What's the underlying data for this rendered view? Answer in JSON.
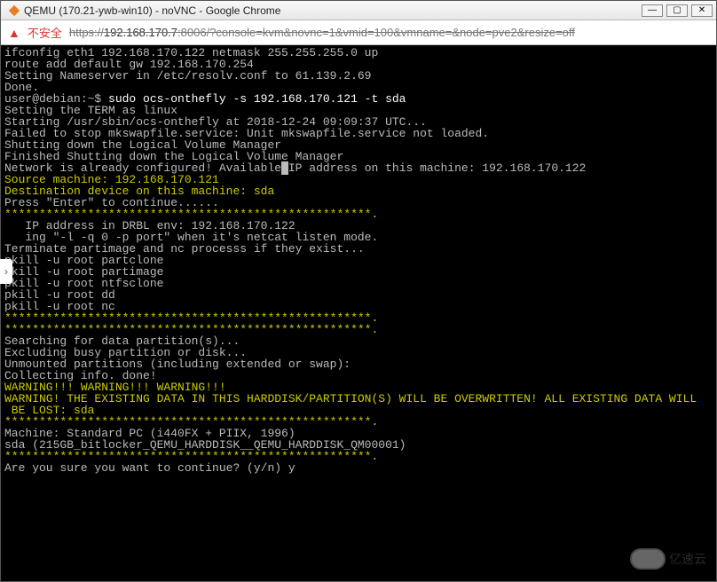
{
  "window": {
    "title": "QEMU (170.21-ywb-win10) - noVNC - Google Chrome",
    "min": "—",
    "max": "▢",
    "close": "✕"
  },
  "addressbar": {
    "insecure_label": "不安全",
    "url_prefix": "https://",
    "url_host": "192.168.170.7",
    "url_rest": ":8006/?console=kvm&novnc=1&vmid=100&vmname=&node=pve2&resize=off"
  },
  "side_tab": "›",
  "terminal": {
    "lines": [
      {
        "t": "ifconfig eth1 192.168.170.122 netmask 255.255.255.0 up"
      },
      {
        "t": "route add default gw 192.168.170.254"
      },
      {
        "t": "Setting Nameserver in /etc/resolv.conf to 61.139.2.69"
      },
      {
        "t": "Done."
      },
      {
        "segs": [
          {
            "t": "user@debian:~$ "
          },
          {
            "cls": "wh",
            "t": "sudo ocs-onthefly -s 192.168.170.121 -t sda"
          }
        ]
      },
      {
        "t": "Setting the TERM as linux"
      },
      {
        "t": "Starting /usr/sbin/ocs-onthefly at 2018-12-24 09:09:37 UTC..."
      },
      {
        "t": "Failed to stop mkswapfile.service: Unit mkswapfile.service not loaded."
      },
      {
        "t": "Shutting down the Logical Volume Manager"
      },
      {
        "t": "Finished Shutting down the Logical Volume Manager"
      },
      {
        "segs": [
          {
            "t": "Network is already configured! Available"
          },
          {
            "cls": "cursor",
            "t": " "
          },
          {
            "t": "IP address on this machine: 192.168.170.122"
          }
        ]
      },
      {
        "cls": "yl",
        "t": "Source machine: 192.168.170.121"
      },
      {
        "cls": "yl",
        "t": "Destination device on this machine: sda"
      },
      {
        "t": "Press \"Enter\" to continue......"
      },
      {
        "cls": "yl",
        "t": "*****************************************************."
      },
      {
        "t": "   IP address in DRBL env: 192.168.170.122"
      },
      {
        "t": "   ing \"-l -q 0 -p port\" when it's netcat listen mode."
      },
      {
        "t": "Terminate partimage and nc processs if they exist..."
      },
      {
        "t": "pkill -u root partclone"
      },
      {
        "t": "pkill -u root partimage"
      },
      {
        "t": "pkill -u root ntfsclone"
      },
      {
        "t": "pkill -u root dd"
      },
      {
        "t": "pkill -u root nc"
      },
      {
        "cls": "yl",
        "t": "*****************************************************."
      },
      {
        "cls": "yl",
        "t": "*****************************************************."
      },
      {
        "t": "Searching for data partition(s)..."
      },
      {
        "t": "Excluding busy partition or disk..."
      },
      {
        "t": "Unmounted partitions (including extended or swap):"
      },
      {
        "t": "Collecting info. done!"
      },
      {
        "cls": "yl",
        "t": "WARNING!!! WARNING!!! WARNING!!!"
      },
      {
        "cls": "yl",
        "t": "WARNING! THE EXISTING DATA IN THIS HARDDISK/PARTITION(S) WILL BE OVERWRITTEN! ALL EXISTING DATA WILL"
      },
      {
        "cls": "yl",
        "t": " BE LOST: sda"
      },
      {
        "cls": "yl",
        "t": "*****************************************************."
      },
      {
        "t": "Machine: Standard PC (i440FX + PIIX, 1996)"
      },
      {
        "t": "sda (215GB_bitlocker_QEMU_HARDDISK__QEMU_HARDDISK_QM00001)"
      },
      {
        "cls": "yl",
        "t": "*****************************************************."
      },
      {
        "t": "Are you sure you want to continue? (y/n) y"
      }
    ]
  },
  "watermark": "亿速云"
}
